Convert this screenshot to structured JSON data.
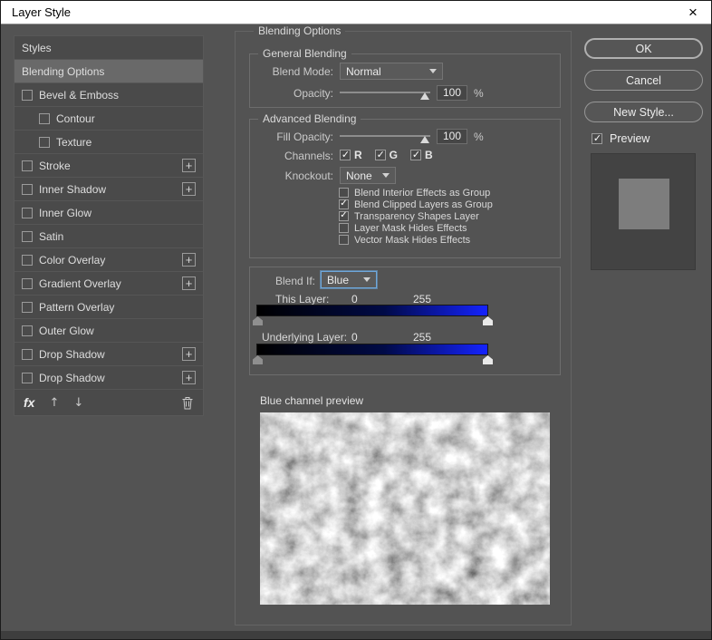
{
  "window": {
    "title": "Layer Style",
    "close_glyph": "×"
  },
  "sidebar": {
    "plus_glyph": "+",
    "items": [
      {
        "label": "Styles",
        "type": "plain",
        "selected": false
      },
      {
        "label": "Blending Options",
        "type": "plain",
        "selected": true
      },
      {
        "label": "Bevel & Emboss",
        "type": "check",
        "checked": false
      },
      {
        "label": "Contour",
        "type": "check",
        "checked": false,
        "indent": true
      },
      {
        "label": "Texture",
        "type": "check",
        "checked": false,
        "indent": true
      },
      {
        "label": "Stroke",
        "type": "check",
        "checked": false,
        "plus": true
      },
      {
        "label": "Inner Shadow",
        "type": "check",
        "checked": false,
        "plus": true
      },
      {
        "label": "Inner Glow",
        "type": "check",
        "checked": false
      },
      {
        "label": "Satin",
        "type": "check",
        "checked": false
      },
      {
        "label": "Color Overlay",
        "type": "check",
        "checked": false,
        "plus": true
      },
      {
        "label": "Gradient Overlay",
        "type": "check",
        "checked": false,
        "plus": true
      },
      {
        "label": "Pattern Overlay",
        "type": "check",
        "checked": false
      },
      {
        "label": "Outer Glow",
        "type": "check",
        "checked": false
      },
      {
        "label": "Drop Shadow",
        "type": "check",
        "checked": false,
        "plus": true
      },
      {
        "label": "Drop Shadow",
        "type": "check",
        "checked": false,
        "plus": true
      }
    ],
    "footer": {
      "fx": "fx",
      "up": "↑",
      "down": "↓"
    }
  },
  "main": {
    "title": "Blending Options",
    "general": {
      "legend": "General Blending",
      "blend_mode_label": "Blend Mode:",
      "blend_mode_value": "Normal",
      "opacity_label": "Opacity:",
      "opacity_value": "100",
      "opacity_unit": "%"
    },
    "advanced": {
      "legend": "Advanced Blending",
      "fill_opacity_label": "Fill Opacity:",
      "fill_opacity_value": "100",
      "fill_opacity_unit": "%",
      "channels_label": "Channels:",
      "channels": [
        {
          "label": "R",
          "checked": true
        },
        {
          "label": "G",
          "checked": true
        },
        {
          "label": "B",
          "checked": true
        }
      ],
      "knockout_label": "Knockout:",
      "knockout_value": "None",
      "options": [
        {
          "label": "Blend Interior Effects as Group",
          "checked": false
        },
        {
          "label": "Blend Clipped Layers as Group",
          "checked": true
        },
        {
          "label": "Transparency Shapes Layer",
          "checked": true
        },
        {
          "label": "Layer Mask Hides Effects",
          "checked": false
        },
        {
          "label": "Vector Mask Hides Effects",
          "checked": false
        }
      ]
    },
    "blend_if": {
      "label": "Blend If:",
      "value": "Blue",
      "this_layer_label": "This Layer:",
      "this_layer_min": "0",
      "this_layer_max": "255",
      "underlying_label": "Underlying Layer:",
      "underlying_min": "0",
      "underlying_max": "255"
    },
    "preview_caption": "Blue channel preview"
  },
  "actions": {
    "ok": "OK",
    "cancel": "Cancel",
    "new_style": "New Style...",
    "preview_label": "Preview",
    "preview_checked": true
  },
  "colors": {
    "dialog_bg": "#535353",
    "titlebar_bg": "#ffffff",
    "selected_row": "#696969",
    "focus_blue": "#6ea8dc",
    "blend_gradient_start": "#000000",
    "blend_gradient_mid": "#000a46",
    "blend_gradient_end": "#1523ff"
  }
}
